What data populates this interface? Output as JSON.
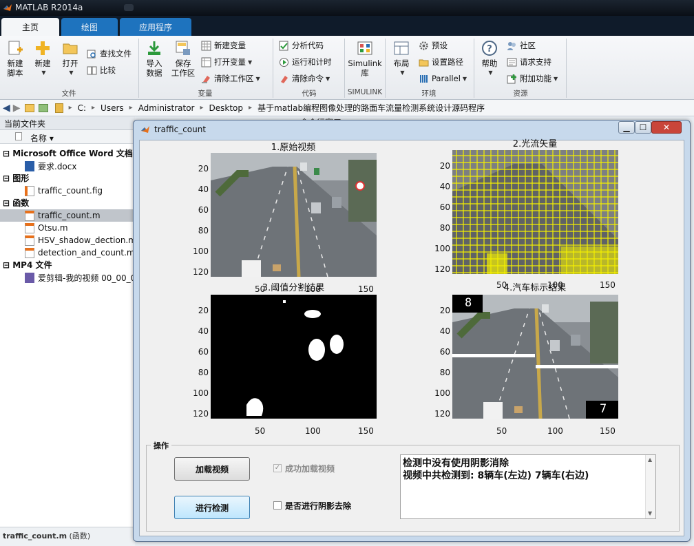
{
  "app": {
    "title": "MATLAB R2014a"
  },
  "tabs": [
    {
      "label": "主页"
    },
    {
      "label": "绘图"
    },
    {
      "label": "应用程序"
    }
  ],
  "ribbon": {
    "file": {
      "new_script": "新建\n脚本",
      "new": "新建",
      "open": "打开",
      "find_files": "查找文件",
      "compare": "比较",
      "group": "文件"
    },
    "variable": {
      "import": "导入\n数据",
      "save": "保存\n工作区",
      "new_var": "新建变量",
      "open_var": "打开变量",
      "clear_ws": "清除工作区",
      "group": "变量"
    },
    "code": {
      "analyze": "分析代码",
      "run_time": "运行和计时",
      "clear_cmd": "清除命令",
      "group": "代码"
    },
    "simulink": {
      "lib": "Simulink\n库",
      "group": "SIMULINK"
    },
    "env": {
      "layout": "布局",
      "prefs": "预设",
      "set_path": "设置路径",
      "parallel": "Parallel",
      "group": "环境"
    },
    "resources": {
      "help": "帮助",
      "community": "社区",
      "support": "请求支持",
      "addons": "附加功能",
      "group": "资源"
    }
  },
  "address": {
    "crumbs": [
      "C:",
      "Users",
      "Administrator",
      "Desktop",
      "基于matlab编程图像处理的路面车流量检测系统设计源码程序"
    ]
  },
  "left": {
    "header": "当前文件夹",
    "col_name": "名称 ▾",
    "sections": [
      {
        "title": "Microsoft Office Word 文档",
        "items": [
          "要求.docx"
        ]
      },
      {
        "title": "图形",
        "items": [
          "traffic_count.fig"
        ]
      },
      {
        "title": "函数",
        "items": [
          "traffic_count.m",
          "Otsu.m",
          "HSV_shadow_dection.m",
          "detection_and_count.m"
        ]
      },
      {
        "title": "MP4 文件",
        "items": [
          "爱剪辑-我的视频 00_00_0"
        ]
      }
    ],
    "selected": "traffic_count.m",
    "footer_name": "traffic_count.m",
    "footer_type": " (函数)",
    "behind_label": "命令行窗口"
  },
  "window": {
    "title": "traffic_count",
    "min": "▁",
    "max": "☐",
    "close": "✕",
    "close_color": "#c9453a"
  },
  "axes": [
    {
      "title": "1.原始视频",
      "yticks": [
        "20",
        "40",
        "60",
        "80",
        "100",
        "120"
      ],
      "xticks": [
        "50",
        "100",
        "150"
      ]
    },
    {
      "title": "2.光流矢量",
      "yticks": [
        "20",
        "40",
        "60",
        "80",
        "100",
        "120"
      ],
      "xticks": [
        "50",
        "100",
        "150"
      ]
    },
    {
      "title": "3.阈值分割结果",
      "yticks": [
        "20",
        "40",
        "60",
        "80",
        "100",
        "120"
      ],
      "xticks": [
        "50",
        "100",
        "150"
      ]
    },
    {
      "title": "4.汽车标示结果",
      "yticks": [
        "20",
        "40",
        "60",
        "80",
        "100",
        "120"
      ],
      "xticks": [
        "50",
        "100",
        "150"
      ],
      "count_left": "8",
      "count_right": "7"
    }
  ],
  "controls": {
    "panel_title": "操作",
    "load_button": "加载视频",
    "detect_button": "进行检测",
    "load_check": "成功加载视频",
    "load_checked": true,
    "shadow_check": "是否进行阴影去除",
    "output_lines": [
      "检测中没有使用阴影消除",
      "视频中共检测到: 8辆车(左边) 7辆车(右边)"
    ]
  }
}
